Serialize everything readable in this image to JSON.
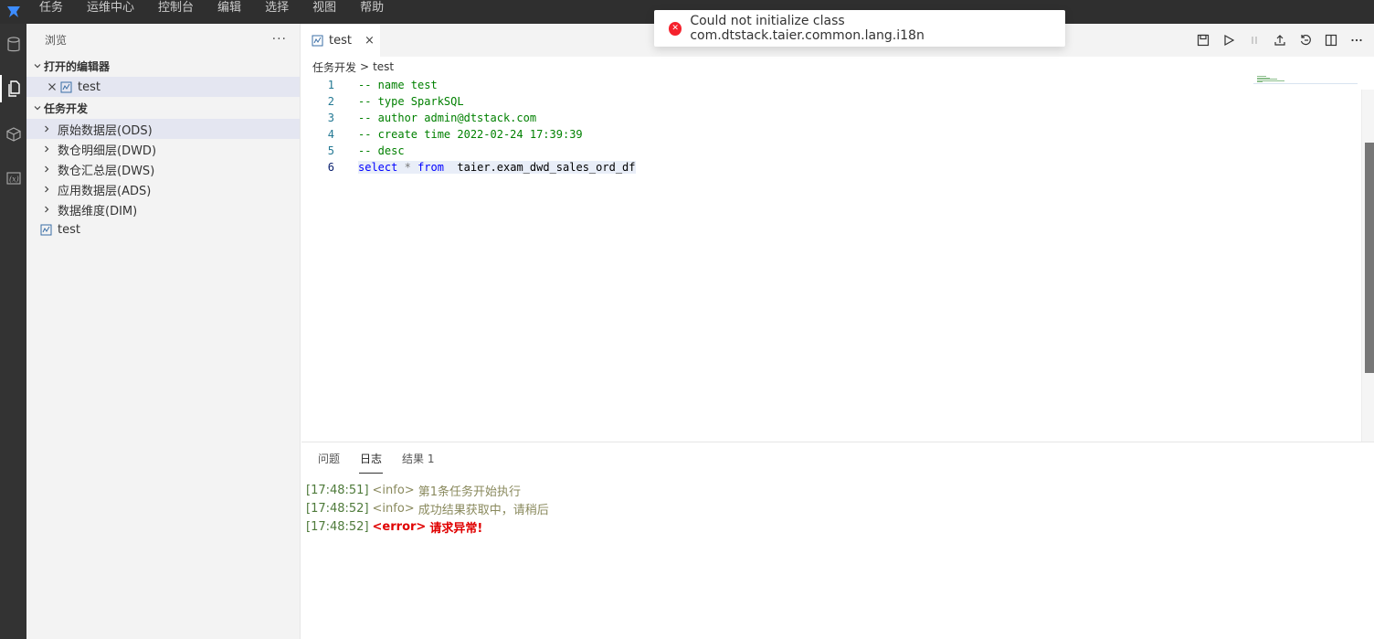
{
  "menu": [
    "任务",
    "运维中心",
    "控制台",
    "编辑",
    "选择",
    "视图",
    "帮助"
  ],
  "sidebar": {
    "title": "浏览",
    "more": "···",
    "open_editors_label": "打开的编辑器",
    "open_editors": [
      {
        "name": "test"
      }
    ],
    "task_dev_label": "任务开发",
    "folders": [
      "原始数据层(ODS)",
      "数仓明细层(DWD)",
      "数仓汇总层(DWS)",
      "应用数据层(ADS)",
      "数据维度(DIM)"
    ],
    "files": [
      "test"
    ]
  },
  "editor": {
    "tab_label": "test",
    "close_glyph": "×",
    "breadcrumb": [
      "任务开发",
      "test"
    ],
    "breadcrumb_sep": ">",
    "lines": [
      {
        "no": "1",
        "text": "-- name test"
      },
      {
        "no": "2",
        "text": "-- type SparkSQL"
      },
      {
        "no": "3",
        "text": "-- author admin@dtstack.com"
      },
      {
        "no": "4",
        "text": "-- create time 2022-02-24 17:39:39"
      },
      {
        "no": "5",
        "text": "-- desc"
      },
      {
        "no": "6",
        "kw1": "select",
        "op": "*",
        "kw2": "from",
        "rest": "taier.exam_dwd_sales_ord_df"
      }
    ]
  },
  "panel": {
    "tabs": [
      "问题",
      "日志",
      "结果 1"
    ],
    "active_tab": "日志",
    "log": [
      {
        "time": "[17:48:51]",
        "level": "<info>",
        "msg": "第1条任务开始执行"
      },
      {
        "time": "[17:48:52]",
        "level": "<info>",
        "msg": "成功结果获取中，请稍后"
      },
      {
        "time": "[17:48:52]",
        "level": "<error>",
        "msg": "请求异常!"
      }
    ]
  },
  "notification": {
    "text": "Could not initialize class com.dtstack.taier.common.lang.i18n",
    "color": "#f5222d"
  },
  "icons": {
    "activity": [
      "database-icon",
      "files-icon",
      "cube-icon",
      "function-icon"
    ],
    "toolbar": [
      "save-icon",
      "run-icon",
      "stop-icon",
      "submit-icon",
      "reload-icon",
      "split-icon",
      "more-icon"
    ]
  }
}
